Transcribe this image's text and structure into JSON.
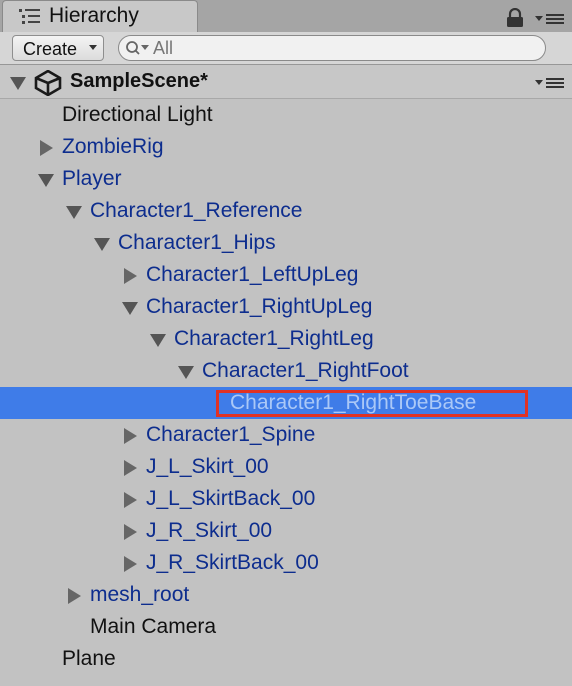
{
  "window": {
    "tab_title": "Hierarchy",
    "tab_icon": "hierarchy-list-icon",
    "lock_icon": "lock-icon",
    "menu_icon": "tab-menu-icon"
  },
  "toolbar": {
    "create_label": "Create",
    "search_placeholder": "All",
    "search_value": ""
  },
  "scene": {
    "title": "SampleScene*",
    "icon": "unity-logo-icon",
    "expanded": true
  },
  "colors": {
    "selection": "#3f7ce8",
    "prefab_text": "#0d2d8e",
    "plain_text": "#111111",
    "highlight_border": "#e03224"
  },
  "tree": [
    {
      "label": "Directional Light",
      "depth": 0,
      "arrow": "none",
      "prefab": false
    },
    {
      "label": "ZombieRig",
      "depth": 0,
      "arrow": "right",
      "prefab": true
    },
    {
      "label": "Player",
      "depth": 0,
      "arrow": "down",
      "prefab": true
    },
    {
      "label": "Character1_Reference",
      "depth": 1,
      "arrow": "down",
      "prefab": true
    },
    {
      "label": "Character1_Hips",
      "depth": 2,
      "arrow": "down",
      "prefab": true
    },
    {
      "label": "Character1_LeftUpLeg",
      "depth": 3,
      "arrow": "right",
      "prefab": true
    },
    {
      "label": "Character1_RightUpLeg",
      "depth": 3,
      "arrow": "down",
      "prefab": true
    },
    {
      "label": "Character1_RightLeg",
      "depth": 4,
      "arrow": "down",
      "prefab": true
    },
    {
      "label": "Character1_RightFoot",
      "depth": 5,
      "arrow": "down",
      "prefab": true
    },
    {
      "label": "Character1_RightToeBase",
      "depth": 6,
      "arrow": "none",
      "prefab": true,
      "selected": true
    },
    {
      "label": "Character1_Spine",
      "depth": 3,
      "arrow": "right",
      "prefab": true
    },
    {
      "label": "J_L_Skirt_00",
      "depth": 3,
      "arrow": "right",
      "prefab": true
    },
    {
      "label": "J_L_SkirtBack_00",
      "depth": 3,
      "arrow": "right",
      "prefab": true
    },
    {
      "label": "J_R_Skirt_00",
      "depth": 3,
      "arrow": "right",
      "prefab": true
    },
    {
      "label": "J_R_SkirtBack_00",
      "depth": 3,
      "arrow": "right",
      "prefab": true
    },
    {
      "label": "mesh_root",
      "depth": 1,
      "arrow": "right",
      "prefab": true
    },
    {
      "label": "Main Camera",
      "depth": 1,
      "arrow": "none",
      "prefab": false
    },
    {
      "label": "Plane",
      "depth": 0,
      "arrow": "none",
      "prefab": false
    }
  ]
}
